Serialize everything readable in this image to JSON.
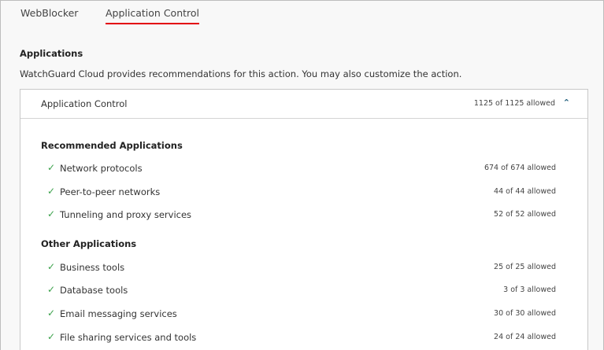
{
  "tabs": [
    {
      "label": "WebBlocker"
    },
    {
      "label": "Application Control"
    }
  ],
  "section": {
    "title": "Applications",
    "description": "WatchGuard Cloud provides recommendations for this action. You may also customize the action."
  },
  "panel": {
    "title": "Application Control",
    "count": "1125 of 1125 allowed",
    "recommended_heading": "Recommended Applications",
    "recommended": [
      {
        "label": "Network protocols",
        "count": "674 of 674 allowed"
      },
      {
        "label": "Peer-to-peer networks",
        "count": "44 of 44 allowed"
      },
      {
        "label": "Tunneling and proxy services",
        "count": "52 of 52 allowed"
      }
    ],
    "other_heading": "Other Applications",
    "other": [
      {
        "label": "Business tools",
        "count": "25 of 25 allowed"
      },
      {
        "label": "Database tools",
        "count": "3 of 3 allowed"
      },
      {
        "label": "Email messaging services",
        "count": "30 of 30 allowed"
      },
      {
        "label": "File sharing services and tools",
        "count": "24 of 24 allowed"
      }
    ]
  },
  "colors": {
    "accent": "#e3000f",
    "check": "#3aa14a"
  }
}
